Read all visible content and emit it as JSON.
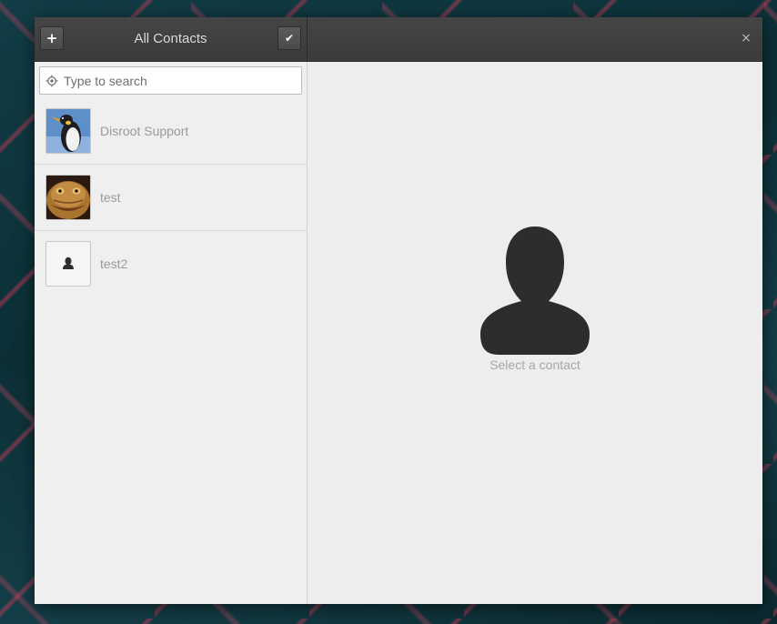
{
  "header": {
    "title": "All Contacts",
    "add_label": "+",
    "select_label": "✔",
    "close_label": "×"
  },
  "search": {
    "placeholder": "Type to search",
    "value": ""
  },
  "contacts": [
    {
      "name": "Disroot Support",
      "avatar": "penguin-photo"
    },
    {
      "name": "test",
      "avatar": "creature-photo"
    },
    {
      "name": "test2",
      "avatar": "default-person-icon"
    }
  ],
  "detail": {
    "empty_text": "Select a contact",
    "empty_icon": "person-silhouette-icon"
  },
  "colors": {
    "headerbar": "#3f3f3f",
    "window_bg": "#ededed",
    "name_text": "#9a9a9a",
    "silhouette": "#2d2d2d"
  }
}
